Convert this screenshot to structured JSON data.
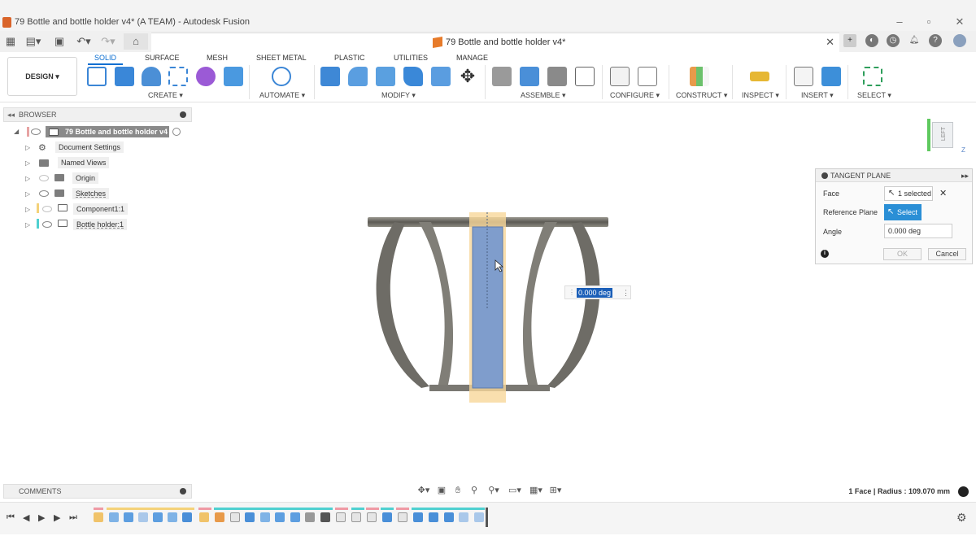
{
  "window": {
    "title": "79 Bottle and bottle holder v4* (A TEAM) - Autodesk Fusion"
  },
  "document_tab": {
    "title": "79 Bottle and bottle holder v4*"
  },
  "workspace": {
    "label": "DESIGN ▾"
  },
  "ribbon_tabs": [
    {
      "label": "SOLID"
    },
    {
      "label": "SURFACE"
    },
    {
      "label": "MESH"
    },
    {
      "label": "SHEET METAL"
    },
    {
      "label": "PLASTIC"
    },
    {
      "label": "UTILITIES"
    },
    {
      "label": "MANAGE"
    }
  ],
  "ribbon_groups": [
    {
      "label": "CREATE ▾"
    },
    {
      "label": "AUTOMATE ▾"
    },
    {
      "label": "MODIFY ▾"
    },
    {
      "label": "ASSEMBLE ▾"
    },
    {
      "label": "CONFIGURE ▾"
    },
    {
      "label": "CONSTRUCT ▾"
    },
    {
      "label": "INSPECT ▾"
    },
    {
      "label": "INSERT ▾"
    },
    {
      "label": "SELECT ▾"
    }
  ],
  "browser": {
    "title": "BROWSER",
    "root": "79 Bottle and bottle holder v4",
    "items": [
      {
        "label": "Document Settings"
      },
      {
        "label": "Named Views"
      },
      {
        "label": "Origin"
      },
      {
        "label": "Sketches"
      },
      {
        "label": "Component1:1"
      },
      {
        "label": "Bottle holder:1"
      }
    ]
  },
  "comments": {
    "title": "COMMENTS"
  },
  "viewcube": {
    "face": "LEFT",
    "axis": "Z"
  },
  "dialog": {
    "title": "TANGENT PLANE",
    "face_label": "Face",
    "face_value": "1 selected",
    "ref_label": "Reference Plane",
    "ref_value": "Select",
    "angle_label": "Angle",
    "angle_value": "0.000 deg",
    "ok": "OK",
    "cancel": "Cancel"
  },
  "float_input": {
    "value": "0.000 deg"
  },
  "status": {
    "text": "1 Face | Radius : 109.070 mm"
  },
  "colors": {
    "accent": "#0a6ed1",
    "plane": "#7f9dcc",
    "selection": "#f7d79a",
    "model": "#6f6d66"
  }
}
